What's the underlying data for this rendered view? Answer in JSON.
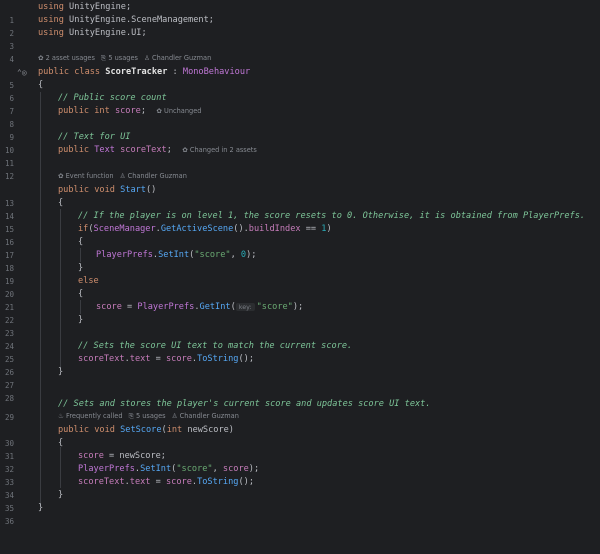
{
  "gutter": {
    "line_numbers": [
      "1",
      "2",
      "3",
      "4",
      "5",
      "6",
      "7",
      "8",
      "9",
      "10",
      "11",
      "12",
      "13",
      "14",
      "15",
      "16",
      "17",
      "18",
      "19",
      "20",
      "21",
      "22",
      "23",
      "24",
      "25",
      "26",
      "27",
      "28",
      "29",
      "30",
      "31",
      "32",
      "33",
      "34",
      "35",
      "36"
    ],
    "class_marker_icon": "run-gutter-icon"
  },
  "hints": {
    "class": {
      "asset_usages": "2 asset usages",
      "usages": "5 usages",
      "author": "Chandler Guzman"
    },
    "score": "Unchanged",
    "scoreText": "Changed in 2 assets",
    "start": {
      "event": "Event function",
      "author": "Chandler Guzman"
    },
    "setScore": {
      "frequency": "Frequently called",
      "usages": "5 usages",
      "author": "Chandler Guzman"
    },
    "param_key": "key:"
  },
  "code": {
    "l1_kw": "using",
    "l1_ns": " UnityEngine;",
    "l2_kw": "using",
    "l2_ns": " UnityEngine.SceneManagement;",
    "l3_kw": "using",
    "l3_ns": " UnityEngine.UI;",
    "l5_kw": "public class",
    "l5_name": "ScoreTracker",
    "l5_colon": " : ",
    "l5_base": "MonoBehaviour",
    "l6": "{",
    "l7": "// Public score count",
    "l8_kw": "public int",
    "l8_name": "score",
    "l8_semi": ";",
    "l10": "// Text for UI",
    "l11_kw": "public",
    "l11_type": "Text",
    "l11_name": "scoreText",
    "l11_semi": ";",
    "l13_kw": "public void",
    "l13_fn": "Start",
    "l13_rest": "()",
    "l14": "{",
    "l15": "// If the player is on level 1, the score resets to 0. Otherwise, it is obtained from PlayerPrefs.",
    "l16_kw": "if",
    "l16_a": "(",
    "l16_cls": "SceneManager",
    "l16_dot": ".",
    "l16_fn": "GetActiveScene",
    "l16_b": "().",
    "l16_fld": "buildIndex",
    "l16_op": " == ",
    "l16_num": "1",
    "l16_c": ")",
    "l17": "{",
    "l18_cls": "PlayerPrefs",
    "l18_dot": ".",
    "l18_fn": "SetInt",
    "l18_a": "(",
    "l18_str": "\"score\"",
    "l18_comma": ", ",
    "l18_num": "0",
    "l18_b": ");",
    "l19": "}",
    "l20": "else",
    "l21": "{",
    "l22_fld": "score",
    "l22_eq": " = ",
    "l22_cls": "PlayerPrefs",
    "l22_dot": ".",
    "l22_fn": "GetInt",
    "l22_a": "(",
    "l22_str": "\"score\"",
    "l22_b": ");",
    "l23": "}",
    "l25": "// Sets the score UI text to match the current score.",
    "l26_fld": "scoreText",
    "l26_dot": ".",
    "l26_fld2": "text",
    "l26_eq": " = ",
    "l26_fld3": "score",
    "l26_dot2": ".",
    "l26_fn": "ToString",
    "l26_b": "();",
    "l27": "}",
    "l29": "// Sets and stores the player's current score and updates score UI text.",
    "l30_kw": "public void",
    "l30_fn": "SetScore",
    "l30_a": "(",
    "l30_kw2": "int",
    "l30_p": " newScore)",
    "l31": "{",
    "l32_fld": "score",
    "l32_rest": " = newScore;",
    "l33_cls": "PlayerPrefs",
    "l33_dot": ".",
    "l33_fn": "SetInt",
    "l33_a": "(",
    "l33_str": "\"score\"",
    "l33_comma": ", ",
    "l33_fld": "score",
    "l33_b": ");",
    "l34_fld": "scoreText",
    "l34_dot": ".",
    "l34_fld2": "text",
    "l34_eq": " = ",
    "l34_fld3": "score",
    "l34_dot2": ".",
    "l34_fn": "ToString",
    "l34_b": "();",
    "l35": "}",
    "l36": "}"
  },
  "hint_icons": {
    "asset": "asset-icon",
    "usages": "usages-icon",
    "author": "person-icon",
    "event": "event-icon",
    "frequent": "fire-icon"
  },
  "colors": {
    "background": "#1e1f22",
    "keyword": "#cf8e6d",
    "type": "#c077d6",
    "function": "#56a8f5",
    "field": "#c77dbb",
    "string": "#6aab73",
    "number": "#2aacb8",
    "comment": "#7ec699"
  }
}
